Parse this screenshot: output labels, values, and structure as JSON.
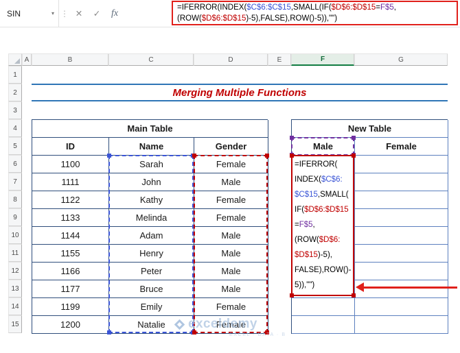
{
  "colors": {
    "navy": "#1F3864",
    "table-border": "#2E4D7B",
    "new-table-border": "#5B7FBE",
    "accent-red": "#C00000",
    "annot-red": "#E0201B",
    "banner-blue": "#2E75B6",
    "ref-blue": "#3B55D6",
    "ref-red": "#C00000",
    "ref-purple": "#7030A0",
    "fill-blue": "#EBF1F9",
    "fill-pink": "#F9E9E8",
    "header-fill": "#F2F2F2",
    "sel-green": "#107C41"
  },
  "toolbar": {
    "name_box": "SIN",
    "dropdown_glyph": "▾",
    "grip_glyph": "⋮",
    "cancel_label": "✕",
    "enter_label": "✓",
    "fx_label": "fx",
    "formula_bar_lines": [
      [
        {
          "t": "=IFERROR(INDEX(",
          "c": "k"
        },
        {
          "t": "$C$6:$C$15",
          "c": "b"
        },
        {
          "t": ",SMALL(IF(",
          "c": "k"
        },
        {
          "t": "$D$6:$D$15",
          "c": "r"
        },
        {
          "t": "=",
          "c": "k"
        },
        {
          "t": "F$5",
          "c": "p"
        },
        {
          "t": ",",
          "c": "k"
        }
      ],
      [
        {
          "t": "(ROW(",
          "c": "k"
        },
        {
          "t": "$D$6:$D$15",
          "c": "r"
        },
        {
          "t": ")-5),FALSE),ROW()-5)),\"\")",
          "c": "k"
        }
      ]
    ]
  },
  "sheet": {
    "col_headers": [
      "A",
      "B",
      "C",
      "D",
      "E",
      "F",
      "G"
    ],
    "active_col": "F",
    "row_headers": [
      "1",
      "2",
      "3",
      "4",
      "5",
      "6",
      "7",
      "8",
      "9",
      "10",
      "11",
      "12",
      "13",
      "14",
      "15"
    ]
  },
  "banner": {
    "title": "Merging Multiple Functions"
  },
  "main_table": {
    "title": "Main Table",
    "headers": [
      "ID",
      "Name",
      "Gender"
    ],
    "rows": [
      [
        "1100",
        "Sarah",
        "Female"
      ],
      [
        "1111",
        "John",
        "Male"
      ],
      [
        "1122",
        "Kathy",
        "Female"
      ],
      [
        "1133",
        "Melinda",
        "Female"
      ],
      [
        "1144",
        "Adam",
        "Male"
      ],
      [
        "1155",
        "Henry",
        "Male"
      ],
      [
        "1166",
        "Peter",
        "Male"
      ],
      [
        "1177",
        "Bruce",
        "Male"
      ],
      [
        "1199",
        "Emily",
        "Female"
      ],
      [
        "1200",
        "Natalie",
        "Female"
      ]
    ]
  },
  "new_table": {
    "title": "New Table",
    "headers": [
      "Male",
      "Female"
    ],
    "empty_rows": 10
  },
  "cell_formula_lines": [
    [
      {
        "t": "=IFERROR(",
        "c": "k"
      }
    ],
    [
      {
        "t": "INDEX(",
        "c": "k"
      },
      {
        "t": "$C$6:",
        "c": "b"
      }
    ],
    [
      {
        "t": "$C$15",
        "c": "b"
      },
      {
        "t": ",SMALL(",
        "c": "k"
      }
    ],
    [
      {
        "t": "IF(",
        "c": "k"
      },
      {
        "t": "$D$6:$D$15",
        "c": "r"
      }
    ],
    [
      {
        "t": "=",
        "c": "k"
      },
      {
        "t": "F$5",
        "c": "p"
      },
      {
        "t": ",",
        "c": "k"
      }
    ],
    [
      {
        "t": "(ROW(",
        "c": "k"
      },
      {
        "t": "$D$6:",
        "c": "r"
      }
    ],
    [
      {
        "t": "$D$15",
        "c": "r"
      },
      {
        "t": ")-5),",
        "c": "k"
      }
    ],
    [
      {
        "t": "FALSE),ROW()-",
        "c": "k"
      }
    ],
    [
      {
        "t": "5)),\"\")",
        "c": "k"
      }
    ]
  ],
  "watermark": {
    "brand": "exceldemy",
    "tagline": "EXCEL · DATA · B"
  }
}
